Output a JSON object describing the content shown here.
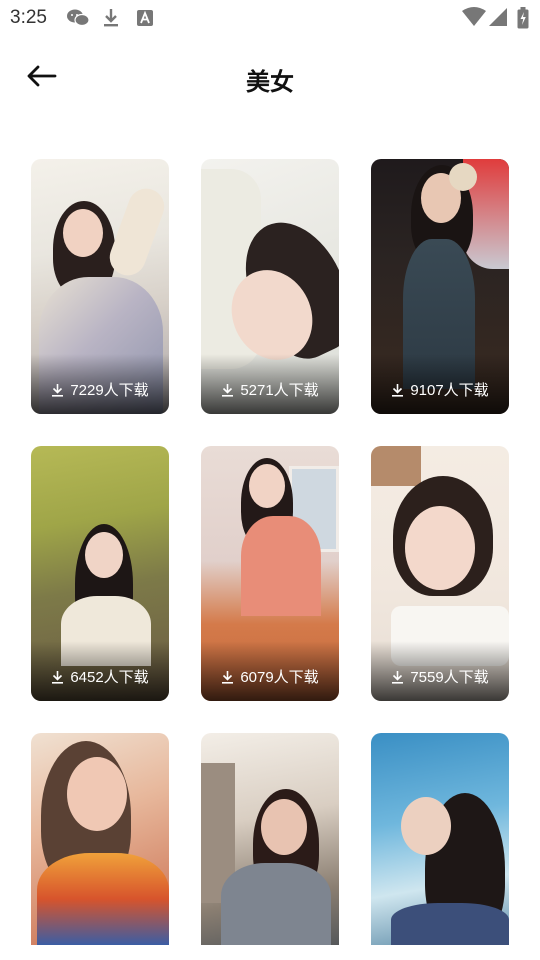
{
  "status_bar": {
    "time": "3:25",
    "icons_left": [
      "wechat-icon",
      "download-icon",
      "text-a-icon"
    ],
    "icons_right": [
      "wifi-icon",
      "signal-icon",
      "battery-charging-icon"
    ]
  },
  "header": {
    "title": "美女",
    "back_icon": "arrow-left-icon"
  },
  "colors": {
    "background": "#ffffff",
    "text": "#111111",
    "overlay_text": "#ffffff"
  },
  "cards": [
    {
      "downloads": "7229人下载"
    },
    {
      "downloads": "5271人下载"
    },
    {
      "downloads": "9107人下载"
    },
    {
      "downloads": "6452人下载"
    },
    {
      "downloads": "6079人下载"
    },
    {
      "downloads": "7559人下载"
    },
    {
      "downloads": ""
    },
    {
      "downloads": ""
    },
    {
      "downloads": ""
    }
  ]
}
